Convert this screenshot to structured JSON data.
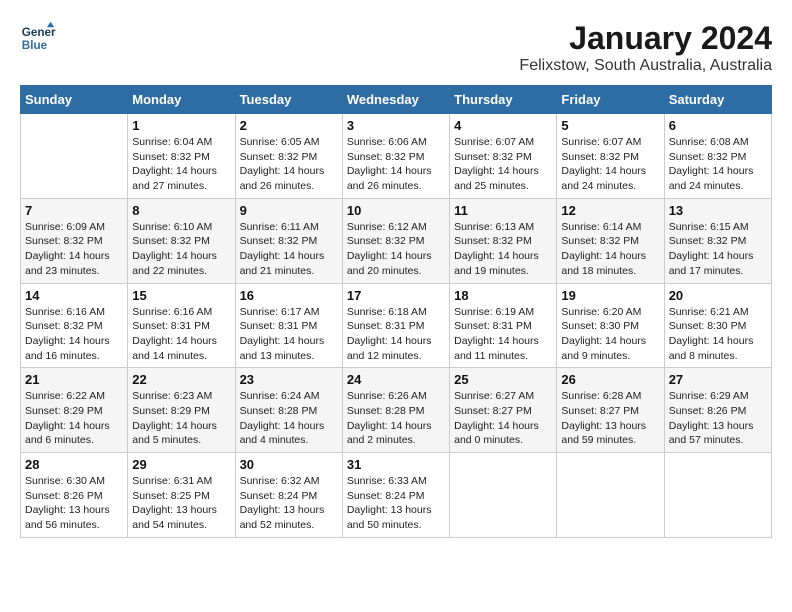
{
  "header": {
    "logo_line1": "General",
    "logo_line2": "Blue",
    "title": "January 2024",
    "subtitle": "Felixstow, South Australia, Australia"
  },
  "calendar": {
    "days_of_week": [
      "Sunday",
      "Monday",
      "Tuesday",
      "Wednesday",
      "Thursday",
      "Friday",
      "Saturday"
    ],
    "weeks": [
      [
        {
          "day": "",
          "details": ""
        },
        {
          "day": "1",
          "details": "Sunrise: 6:04 AM\nSunset: 8:32 PM\nDaylight: 14 hours\nand 27 minutes."
        },
        {
          "day": "2",
          "details": "Sunrise: 6:05 AM\nSunset: 8:32 PM\nDaylight: 14 hours\nand 26 minutes."
        },
        {
          "day": "3",
          "details": "Sunrise: 6:06 AM\nSunset: 8:32 PM\nDaylight: 14 hours\nand 26 minutes."
        },
        {
          "day": "4",
          "details": "Sunrise: 6:07 AM\nSunset: 8:32 PM\nDaylight: 14 hours\nand 25 minutes."
        },
        {
          "day": "5",
          "details": "Sunrise: 6:07 AM\nSunset: 8:32 PM\nDaylight: 14 hours\nand 24 minutes."
        },
        {
          "day": "6",
          "details": "Sunrise: 6:08 AM\nSunset: 8:32 PM\nDaylight: 14 hours\nand 24 minutes."
        }
      ],
      [
        {
          "day": "7",
          "details": "Sunrise: 6:09 AM\nSunset: 8:32 PM\nDaylight: 14 hours\nand 23 minutes."
        },
        {
          "day": "8",
          "details": "Sunrise: 6:10 AM\nSunset: 8:32 PM\nDaylight: 14 hours\nand 22 minutes."
        },
        {
          "day": "9",
          "details": "Sunrise: 6:11 AM\nSunset: 8:32 PM\nDaylight: 14 hours\nand 21 minutes."
        },
        {
          "day": "10",
          "details": "Sunrise: 6:12 AM\nSunset: 8:32 PM\nDaylight: 14 hours\nand 20 minutes."
        },
        {
          "day": "11",
          "details": "Sunrise: 6:13 AM\nSunset: 8:32 PM\nDaylight: 14 hours\nand 19 minutes."
        },
        {
          "day": "12",
          "details": "Sunrise: 6:14 AM\nSunset: 8:32 PM\nDaylight: 14 hours\nand 18 minutes."
        },
        {
          "day": "13",
          "details": "Sunrise: 6:15 AM\nSunset: 8:32 PM\nDaylight: 14 hours\nand 17 minutes."
        }
      ],
      [
        {
          "day": "14",
          "details": "Sunrise: 6:16 AM\nSunset: 8:32 PM\nDaylight: 14 hours\nand 16 minutes."
        },
        {
          "day": "15",
          "details": "Sunrise: 6:16 AM\nSunset: 8:31 PM\nDaylight: 14 hours\nand 14 minutes."
        },
        {
          "day": "16",
          "details": "Sunrise: 6:17 AM\nSunset: 8:31 PM\nDaylight: 14 hours\nand 13 minutes."
        },
        {
          "day": "17",
          "details": "Sunrise: 6:18 AM\nSunset: 8:31 PM\nDaylight: 14 hours\nand 12 minutes."
        },
        {
          "day": "18",
          "details": "Sunrise: 6:19 AM\nSunset: 8:31 PM\nDaylight: 14 hours\nand 11 minutes."
        },
        {
          "day": "19",
          "details": "Sunrise: 6:20 AM\nSunset: 8:30 PM\nDaylight: 14 hours\nand 9 minutes."
        },
        {
          "day": "20",
          "details": "Sunrise: 6:21 AM\nSunset: 8:30 PM\nDaylight: 14 hours\nand 8 minutes."
        }
      ],
      [
        {
          "day": "21",
          "details": "Sunrise: 6:22 AM\nSunset: 8:29 PM\nDaylight: 14 hours\nand 6 minutes."
        },
        {
          "day": "22",
          "details": "Sunrise: 6:23 AM\nSunset: 8:29 PM\nDaylight: 14 hours\nand 5 minutes."
        },
        {
          "day": "23",
          "details": "Sunrise: 6:24 AM\nSunset: 8:28 PM\nDaylight: 14 hours\nand 4 minutes."
        },
        {
          "day": "24",
          "details": "Sunrise: 6:26 AM\nSunset: 8:28 PM\nDaylight: 14 hours\nand 2 minutes."
        },
        {
          "day": "25",
          "details": "Sunrise: 6:27 AM\nSunset: 8:27 PM\nDaylight: 14 hours\nand 0 minutes."
        },
        {
          "day": "26",
          "details": "Sunrise: 6:28 AM\nSunset: 8:27 PM\nDaylight: 13 hours\nand 59 minutes."
        },
        {
          "day": "27",
          "details": "Sunrise: 6:29 AM\nSunset: 8:26 PM\nDaylight: 13 hours\nand 57 minutes."
        }
      ],
      [
        {
          "day": "28",
          "details": "Sunrise: 6:30 AM\nSunset: 8:26 PM\nDaylight: 13 hours\nand 56 minutes."
        },
        {
          "day": "29",
          "details": "Sunrise: 6:31 AM\nSunset: 8:25 PM\nDaylight: 13 hours\nand 54 minutes."
        },
        {
          "day": "30",
          "details": "Sunrise: 6:32 AM\nSunset: 8:24 PM\nDaylight: 13 hours\nand 52 minutes."
        },
        {
          "day": "31",
          "details": "Sunrise: 6:33 AM\nSunset: 8:24 PM\nDaylight: 13 hours\nand 50 minutes."
        },
        {
          "day": "",
          "details": ""
        },
        {
          "day": "",
          "details": ""
        },
        {
          "day": "",
          "details": ""
        }
      ]
    ]
  }
}
